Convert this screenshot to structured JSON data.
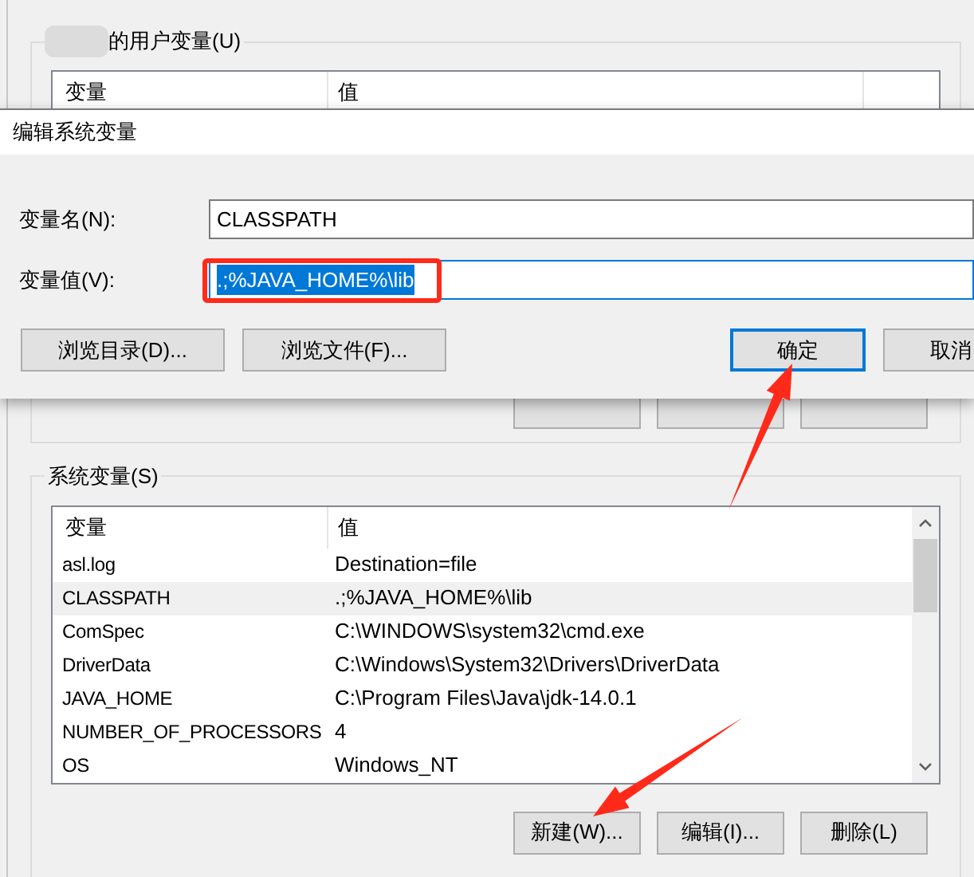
{
  "user_variables": {
    "legend": "的用户变量(U)",
    "columns": [
      "变量",
      "值"
    ]
  },
  "system_variables": {
    "legend": "系统变量(S)",
    "columns": [
      "变量",
      "值"
    ],
    "rows": [
      {
        "name": "asl.log",
        "value": "Destination=file",
        "selected": false
      },
      {
        "name": "CLASSPATH",
        "value": ".;%JAVA_HOME%\\lib",
        "selected": true
      },
      {
        "name": "ComSpec",
        "value": "C:\\WINDOWS\\system32\\cmd.exe",
        "selected": false
      },
      {
        "name": "DriverData",
        "value": "C:\\Windows\\System32\\Drivers\\DriverData",
        "selected": false
      },
      {
        "name": "JAVA_HOME",
        "value": "C:\\Program Files\\Java\\jdk-14.0.1",
        "selected": false
      },
      {
        "name": "NUMBER_OF_PROCESSORS",
        "value": "4",
        "selected": false
      },
      {
        "name": "OS",
        "value": "Windows_NT",
        "selected": false
      }
    ],
    "buttons": [
      "新建(W)...",
      "编辑(I)...",
      "删除(L)"
    ]
  },
  "dialog": {
    "title": "编辑系统变量",
    "fields": [
      {
        "label": "变量名(N):",
        "value": "CLASSPATH",
        "selected": false,
        "focused": false
      },
      {
        "label": "变量值(V):",
        "value": ".;%JAVA_HOME%\\lib",
        "selected": true,
        "focused": true
      }
    ],
    "left_buttons": [
      "浏览目录(D)...",
      "浏览文件(F)..."
    ],
    "right_buttons": [
      {
        "label": "确定",
        "default": true
      },
      {
        "label": "取消",
        "default": false
      }
    ]
  }
}
